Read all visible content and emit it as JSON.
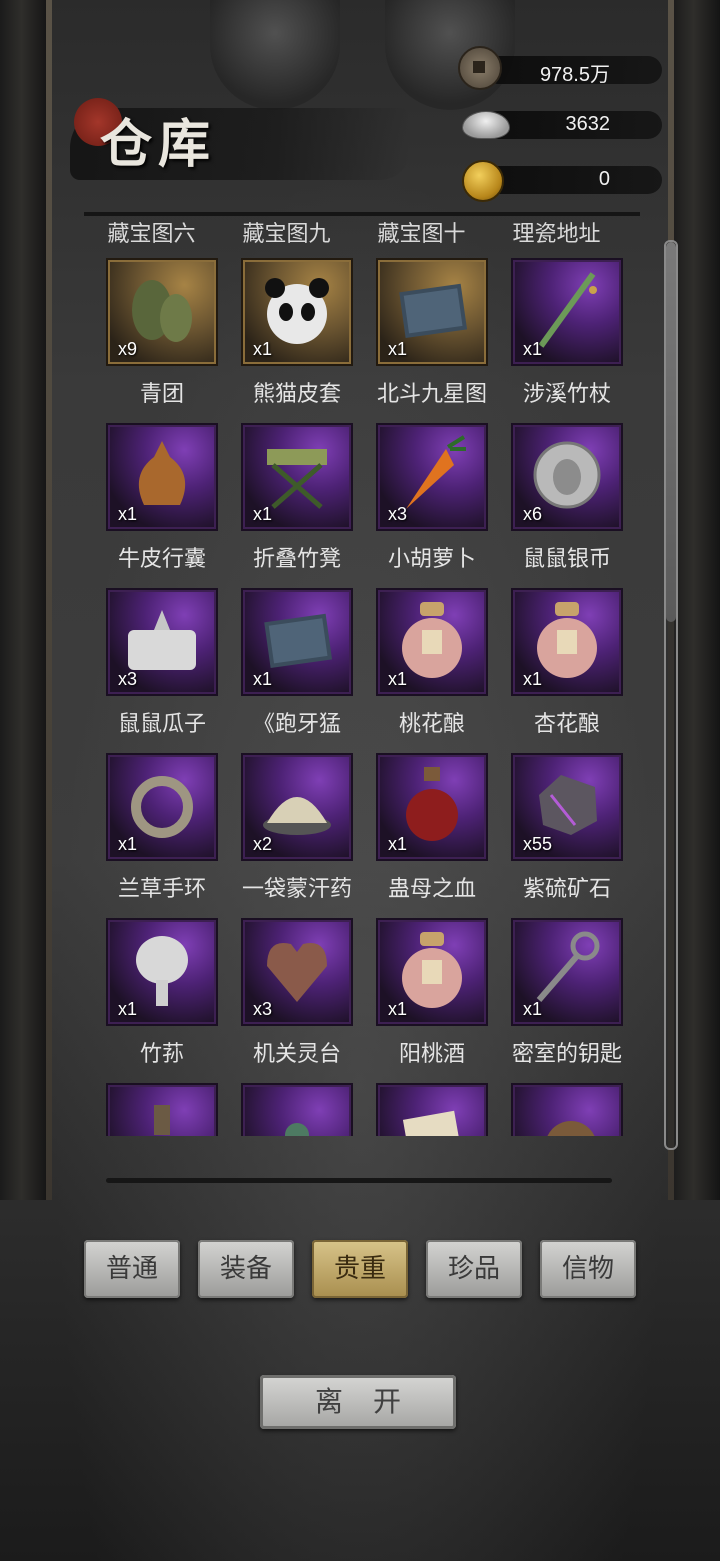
{
  "title": "仓库",
  "currency": [
    {
      "icon": "copper-coin-icon",
      "value": "978.5万"
    },
    {
      "icon": "silver-ingot-icon",
      "value": "3632"
    },
    {
      "icon": "gold-coin-icon",
      "value": "0"
    }
  ],
  "cut_row": [
    "藏宝图六",
    "藏宝图九",
    "藏宝图十",
    "理瓷地址"
  ],
  "items": [
    {
      "name": "青团",
      "qty": "x9",
      "rarity": "gold",
      "icon": "qingtuan-icon"
    },
    {
      "name": "熊猫皮套",
      "qty": "x1",
      "rarity": "gold",
      "icon": "panda-mask-icon"
    },
    {
      "name": "北斗九星图",
      "qty": "x1",
      "rarity": "gold",
      "icon": "book-icon"
    },
    {
      "name": "涉溪竹杖",
      "qty": "x1",
      "rarity": "purple",
      "icon": "bamboo-staff-icon"
    },
    {
      "name": "牛皮行囊",
      "qty": "x1",
      "rarity": "purple",
      "icon": "leather-bag-icon"
    },
    {
      "name": "折叠竹凳",
      "qty": "x1",
      "rarity": "purple",
      "icon": "bamboo-stool-icon"
    },
    {
      "name": "小胡萝卜",
      "qty": "x3",
      "rarity": "purple",
      "icon": "carrot-icon"
    },
    {
      "name": "鼠鼠银币",
      "qty": "x6",
      "rarity": "purple",
      "icon": "silver-coin-icon"
    },
    {
      "name": "鼠鼠瓜子",
      "qty": "x3",
      "rarity": "purple",
      "icon": "seed-pack-icon"
    },
    {
      "name": "《跑牙猛",
      "qty": "x1",
      "rarity": "purple",
      "icon": "book-icon"
    },
    {
      "name": "桃花酿",
      "qty": "x1",
      "rarity": "purple",
      "icon": "wine-jar-icon"
    },
    {
      "name": "杏花酿",
      "qty": "x1",
      "rarity": "purple",
      "icon": "wine-jar-icon"
    },
    {
      "name": "兰草手环",
      "qty": "x1",
      "rarity": "purple",
      "icon": "grass-bracelet-icon"
    },
    {
      "name": "一袋蒙汗药",
      "qty": "x2",
      "rarity": "purple",
      "icon": "powder-icon"
    },
    {
      "name": "蛊母之血",
      "qty": "x1",
      "rarity": "purple",
      "icon": "blood-bottle-icon"
    },
    {
      "name": "紫硫矿石",
      "qty": "x55",
      "rarity": "purple",
      "icon": "ore-icon"
    },
    {
      "name": "竹荪",
      "qty": "x1",
      "rarity": "purple",
      "icon": "mushroom-icon"
    },
    {
      "name": "机关灵台",
      "qty": "x3",
      "rarity": "purple",
      "icon": "mechanical-heart-icon"
    },
    {
      "name": "阳桃酒",
      "qty": "x1",
      "rarity": "purple",
      "icon": "wine-jar-icon"
    },
    {
      "name": "密室的钥匙",
      "qty": "x1",
      "rarity": "purple",
      "icon": "key-icon"
    },
    {
      "name": "",
      "qty": "",
      "rarity": "purple",
      "icon": "vase-icon"
    },
    {
      "name": "",
      "qty": "",
      "rarity": "purple",
      "icon": "ornament-icon"
    },
    {
      "name": "",
      "qty": "",
      "rarity": "purple",
      "icon": "letter-icon"
    },
    {
      "name": "",
      "qty": "",
      "rarity": "purple",
      "icon": "rope-ball-icon"
    }
  ],
  "tabs": [
    {
      "label": "普通",
      "active": false
    },
    {
      "label": "装备",
      "active": false
    },
    {
      "label": "贵重",
      "active": true
    },
    {
      "label": "珍品",
      "active": false
    },
    {
      "label": "信物",
      "active": false
    }
  ],
  "leave_label": "离开"
}
